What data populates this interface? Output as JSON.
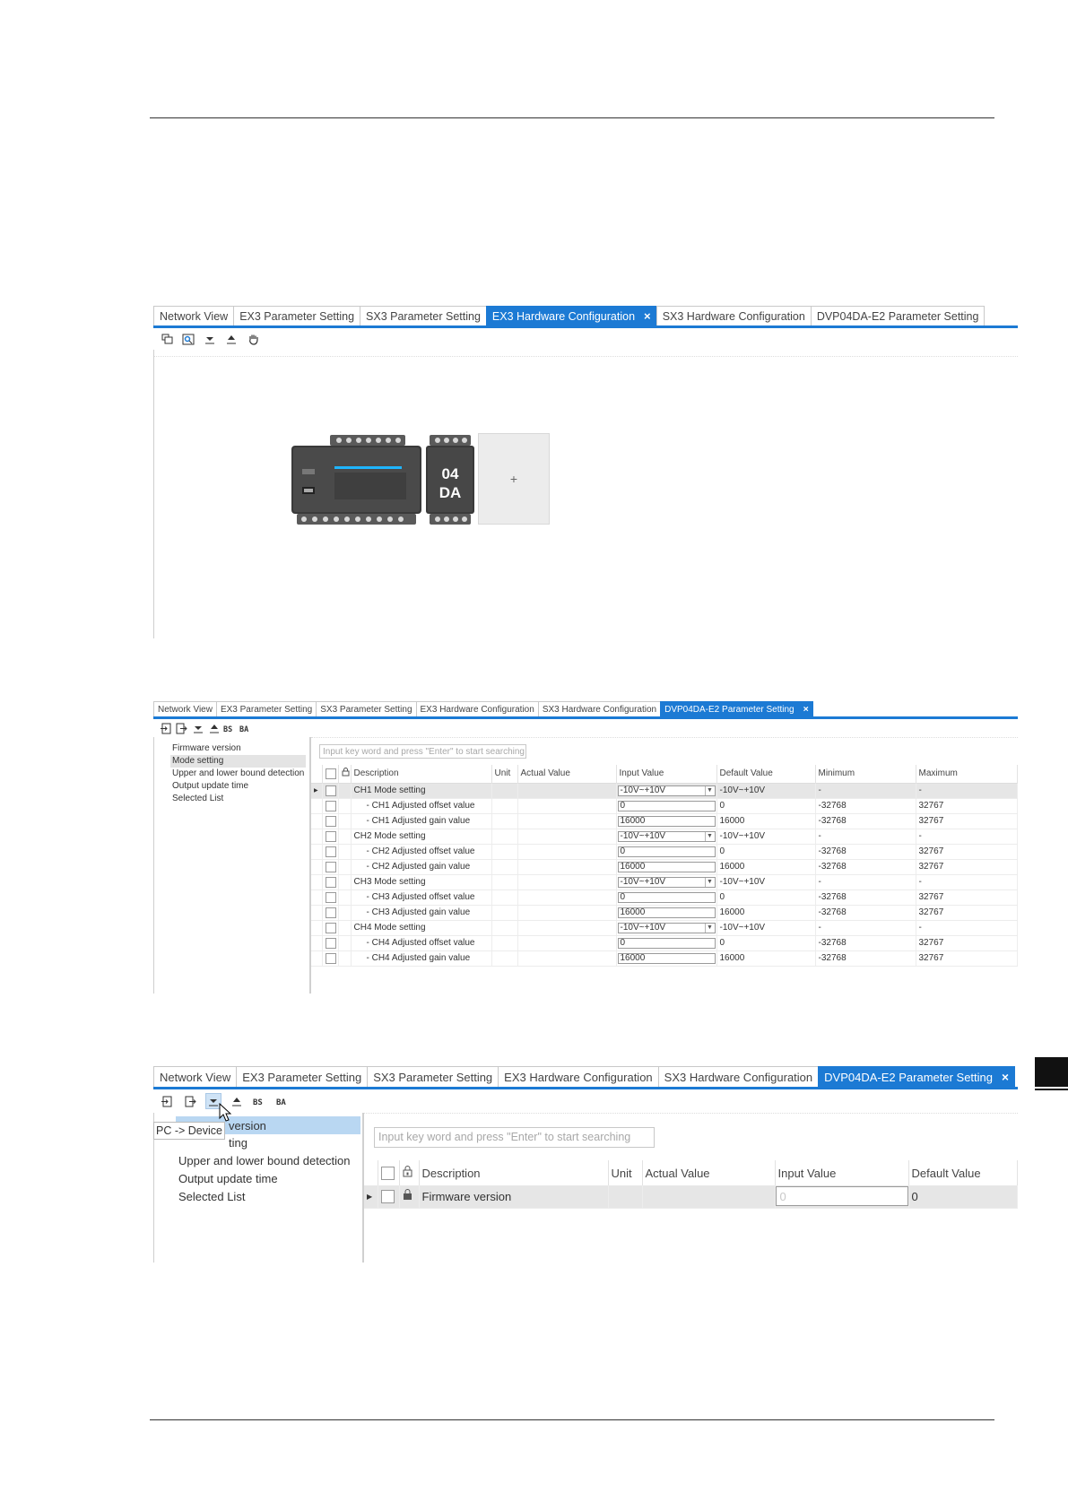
{
  "tabs_wide": [
    "Network View",
    "EX3 Parameter Setting",
    "SX3 Parameter Setting",
    "EX3 Hardware Configuration",
    "SX3 Hardware Configuration",
    "DVP04DA-E2 Parameter Setting"
  ],
  "tabs_close": "×",
  "icons": {
    "top_toolbar": [
      "copy-icon",
      "scan-icon",
      "download-icon",
      "upload-icon",
      "hand-icon"
    ],
    "param_toolbar": [
      "import-icon",
      "export-icon",
      "download-icon",
      "upload-icon",
      "hex-bit-icon",
      "hex-data-icon"
    ]
  },
  "shot1": {
    "active_tab_index": 3,
    "module_label_line1": "04",
    "module_label_line2": "DA",
    "empty_slot_symbol": "+"
  },
  "sidebar_items": [
    "Firmware version",
    "Mode setting",
    "Upper and lower bound detection",
    "Output update time",
    "Selected List"
  ],
  "search_placeholder": "Input key word and press \"Enter\" to start searching",
  "shot2": {
    "active_tab_index": 5,
    "selected_side_index": 1,
    "columns": [
      "Description",
      "Unit",
      "Actual Value",
      "Input Value",
      "Default Value",
      "Minimum",
      "Maximum"
    ],
    "rows": [
      {
        "desc": "CH1 Mode setting",
        "unit": "",
        "actual": "",
        "input": "-10V~+10V",
        "dropdown": true,
        "default": "-10V~+10V",
        "min": "-",
        "max": "-",
        "indent": false,
        "hi": true,
        "arrow": true
      },
      {
        "desc": "- CH1 Adjusted offset value",
        "unit": "",
        "actual": "",
        "input": "0",
        "dropdown": false,
        "default": "0",
        "min": "-32768",
        "max": "32767",
        "indent": true
      },
      {
        "desc": "- CH1 Adjusted gain value",
        "unit": "",
        "actual": "",
        "input": "16000",
        "dropdown": false,
        "default": "16000",
        "min": "-32768",
        "max": "32767",
        "indent": true
      },
      {
        "desc": "CH2 Mode setting",
        "unit": "",
        "actual": "",
        "input": "-10V~+10V",
        "dropdown": true,
        "default": "-10V~+10V",
        "min": "-",
        "max": "-",
        "indent": false
      },
      {
        "desc": "- CH2 Adjusted offset value",
        "unit": "",
        "actual": "",
        "input": "0",
        "dropdown": false,
        "default": "0",
        "min": "-32768",
        "max": "32767",
        "indent": true
      },
      {
        "desc": "- CH2 Adjusted gain value",
        "unit": "",
        "actual": "",
        "input": "16000",
        "dropdown": false,
        "default": "16000",
        "min": "-32768",
        "max": "32767",
        "indent": true
      },
      {
        "desc": "CH3 Mode setting",
        "unit": "",
        "actual": "",
        "input": "-10V~+10V",
        "dropdown": true,
        "default": "-10V~+10V",
        "min": "-",
        "max": "-",
        "indent": false
      },
      {
        "desc": "- CH3 Adjusted offset value",
        "unit": "",
        "actual": "",
        "input": "0",
        "dropdown": false,
        "default": "0",
        "min": "-32768",
        "max": "32767",
        "indent": true
      },
      {
        "desc": "- CH3 Adjusted gain value",
        "unit": "",
        "actual": "",
        "input": "16000",
        "dropdown": false,
        "default": "16000",
        "min": "-32768",
        "max": "32767",
        "indent": true
      },
      {
        "desc": "CH4 Mode setting",
        "unit": "",
        "actual": "",
        "input": "-10V~+10V",
        "dropdown": true,
        "default": "-10V~+10V",
        "min": "-",
        "max": "-",
        "indent": false
      },
      {
        "desc": "- CH4 Adjusted offset value",
        "unit": "",
        "actual": "",
        "input": "0",
        "dropdown": false,
        "default": "0",
        "min": "-32768",
        "max": "32767",
        "indent": true
      },
      {
        "desc": "- CH4 Adjusted gain value",
        "unit": "",
        "actual": "",
        "input": "16000",
        "dropdown": false,
        "default": "16000",
        "min": "-32768",
        "max": "32767",
        "indent": true
      }
    ]
  },
  "shot3": {
    "active_tab_index": 5,
    "selected_side_index": 0,
    "tooltip": "PC -> Device",
    "side_item_0_visible": "version",
    "side_item_1_visible": "ting",
    "columns": [
      "Description",
      "Unit",
      "Actual Value",
      "Input Value",
      "Default Value"
    ],
    "rows": [
      {
        "desc": "Firmware version",
        "unit": "",
        "actual": "",
        "input": "0",
        "default": "0"
      }
    ]
  },
  "colors": {
    "accent": "#1c7ad4",
    "row_highlight": "#e6e6e6",
    "side_selected": "#cfe3f6"
  }
}
